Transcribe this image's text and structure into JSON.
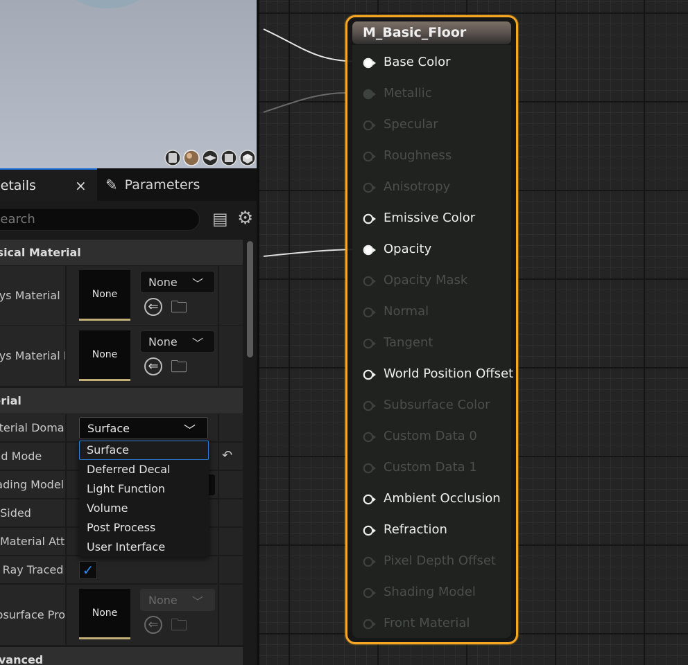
{
  "tabs": {
    "details": {
      "label": "Details",
      "close": "×"
    },
    "parameters": {
      "label": "Parameters",
      "icon": "pencil-icon"
    }
  },
  "search": {
    "placeholder": "Search"
  },
  "sections": {
    "physical_material": "Physical Material",
    "material": "Material",
    "advanced": "Advanced"
  },
  "properties": {
    "phys_material": {
      "label": "Phys Material",
      "thumb": "None",
      "value": "None"
    },
    "phys_material_mask": {
      "label": "Phys Material Mask",
      "thumb": "None",
      "value": "None"
    },
    "material_domain": {
      "label": "Material Domain",
      "value": "Surface"
    },
    "blend_mode": {
      "label": "Blend Mode"
    },
    "shading_model": {
      "label": "Shading Model"
    },
    "two_sided": {
      "label": "Two Sided"
    },
    "use_material_attributes": {
      "label": "Use Material Attributes"
    },
    "cast_ray_traced_shadows": {
      "label": "Cast Ray Traced Shadows",
      "checked": true
    },
    "subsurface_profile": {
      "label": "Subsurface Profile",
      "thumb": "None",
      "value": "None"
    }
  },
  "domain_options": [
    "Surface",
    "Deferred Decal",
    "Light Function",
    "Volume",
    "Post Process",
    "User Interface"
  ],
  "domain_selected": "Surface",
  "node": {
    "title": "M_Basic_Floor",
    "accent_color": "#f5a623",
    "pins": [
      {
        "label": "Base Color",
        "state": "connected"
      },
      {
        "label": "Metallic",
        "state": "disabled-filled"
      },
      {
        "label": "Specular",
        "state": "disabled"
      },
      {
        "label": "Roughness",
        "state": "disabled"
      },
      {
        "label": "Anisotropy",
        "state": "disabled"
      },
      {
        "label": "Emissive Color",
        "state": "enabled"
      },
      {
        "label": "Opacity",
        "state": "connected"
      },
      {
        "label": "Opacity Mask",
        "state": "disabled"
      },
      {
        "label": "Normal",
        "state": "disabled"
      },
      {
        "label": "Tangent",
        "state": "disabled"
      },
      {
        "label": "World Position Offset",
        "state": "enabled"
      },
      {
        "label": "Subsurface Color",
        "state": "disabled"
      },
      {
        "label": "Custom Data 0",
        "state": "disabled"
      },
      {
        "label": "Custom Data 1",
        "state": "disabled"
      },
      {
        "label": "Ambient Occlusion",
        "state": "enabled"
      },
      {
        "label": "Refraction",
        "state": "enabled"
      },
      {
        "label": "Pixel Depth Offset",
        "state": "disabled"
      },
      {
        "label": "Shading Model",
        "state": "disabled"
      },
      {
        "label": "Front Material",
        "state": "disabled"
      }
    ]
  },
  "preview_shapes": [
    "cylinder-icon",
    "sphere-icon",
    "plane-icon",
    "cube-icon",
    "custom-mesh-icon"
  ]
}
